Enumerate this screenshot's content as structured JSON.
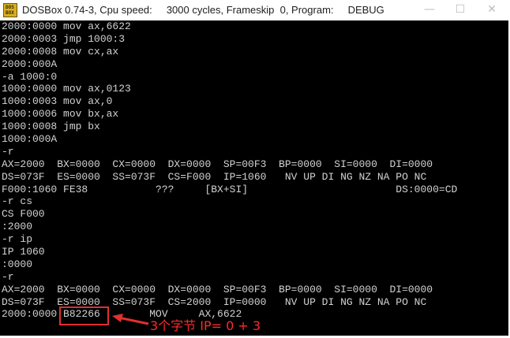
{
  "window": {
    "icon_text_top": "DOS",
    "icon_text_bottom": "BOX",
    "title": "DOSBox 0.74-3, Cpu speed:     3000 cycles, Frameskip  0, Program:     DEBUG",
    "minimize": "—",
    "maximize": "☐",
    "close": "✕"
  },
  "console": {
    "lines": [
      "2000:0000 mov ax,6622",
      "2000:0003 jmp 1000:3",
      "2000:0008 mov cx,ax",
      "2000:000A",
      "-a 1000:0",
      "1000:0000 mov ax,0123",
      "1000:0003 mov ax,0",
      "1000:0006 mov bx,ax",
      "1000:0008 jmp bx",
      "1000:000A",
      "-r",
      "AX=2000  BX=0000  CX=0000  DX=0000  SP=00F3  BP=0000  SI=0000  DI=0000",
      "DS=073F  ES=0000  SS=073F  CS=F000  IP=1060   NV UP DI NG NZ NA PO NC",
      "F000:1060 FE38           ???     [BX+SI]                        DS:0000=CD",
      "-r cs",
      "CS F000",
      ":2000",
      "-r ip",
      "IP 1060",
      ":0000",
      "-r",
      "AX=2000  BX=0000  CX=0000  DX=0000  SP=00F3  BP=0000  SI=0000  DI=0000",
      "DS=073F  ES=0000  SS=073F  CS=2000  IP=0000   NV UP DI NG NZ NA PO NC",
      "2000:0000 B82266        MOV     AX,6622"
    ]
  },
  "annotation": {
    "text": "3个字节 IP= 0 + 3",
    "color": "#ff2a2a"
  }
}
